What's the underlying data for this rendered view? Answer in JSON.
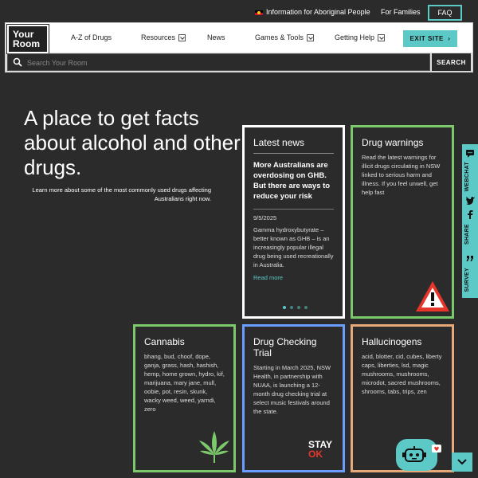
{
  "topbar": {
    "aboriginal_link": "Information for Aboriginal People",
    "families_link": "For Families",
    "faq": "FAQ"
  },
  "logo": {
    "line1": "Your",
    "line2": "Room"
  },
  "nav": {
    "items": [
      {
        "label": "A-Z of Drugs",
        "dropdown": false
      },
      {
        "label": "Resources",
        "dropdown": true
      },
      {
        "label": "News",
        "dropdown": false
      },
      {
        "label": "Games & Tools",
        "dropdown": true
      },
      {
        "label": "Getting Help",
        "dropdown": true
      }
    ],
    "exit": "EXIT SITE"
  },
  "search": {
    "placeholder": "Search Your Room",
    "button": "SEARCH"
  },
  "hero": {
    "title": "A place to get facts about alcohol and other drugs.",
    "subtitle": "Learn more about some of the most commonly used drugs affecting Australians right now."
  },
  "news": {
    "heading": "Latest news",
    "headline": "More Australians are overdosing on GHB. But there are ways to reduce your risk",
    "date": "9/5/2025",
    "body": "Gamma hydroxybutyrate – better known as GHB – is an increasingly popular illegal drug being used recreationally in Australia.",
    "read_more": "Read more",
    "slides": 4,
    "active_slide": 1
  },
  "warnings": {
    "heading": "Drug warnings",
    "body": "Read the latest warnings for illicit drugs circulating in NSW linked to serious harm and illness. If you feel unwell, get help fast"
  },
  "cannabis": {
    "heading": "Cannabis",
    "body": "bhang, bud, choof, dope, ganja, grass, hash, hashish, hemp, home grown, hydro, kif, marijuana, mary jane, mull, oobie, pot, resin, skunk, wacky weed, weed, yarndi, zero"
  },
  "trial": {
    "heading": "Drug Checking Trial",
    "body": "Starting in March 2025, NSW Health, in partnership with NUAA, is launching a 12-month drug checking trial at select music festivals around the state.",
    "logo_top": "STAY",
    "logo_bottom": "OK"
  },
  "hallucinogens": {
    "heading": "Hallucinogens",
    "body": "acid, blotter, cid, cubes, liberty caps, liberties, lsd, magic mushrooms, mushrooms, microdot, sacred mushrooms, shrooms, tabs, trips, zen"
  },
  "sidebar": {
    "webchat": "WEBCHAT",
    "share": "SHARE",
    "survey": "SURVEY"
  },
  "colors": {
    "accent": "#5cc9c6",
    "green": "#7cc96b",
    "blue": "#6b9cff",
    "orange": "#e8a97a",
    "bg": "#2b2b2b"
  }
}
